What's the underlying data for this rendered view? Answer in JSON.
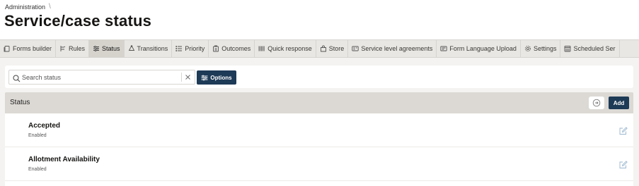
{
  "breadcrumb": {
    "items": [
      "Administration"
    ],
    "separator": "\\"
  },
  "page": {
    "title": "Service/case status"
  },
  "tabs": [
    {
      "label": "Forms builder",
      "icon": "forms-icon",
      "active": false
    },
    {
      "label": "Rules",
      "icon": "rules-icon",
      "active": false
    },
    {
      "label": "Status",
      "icon": "status-icon",
      "active": true
    },
    {
      "label": "Transitions",
      "icon": "transitions-icon",
      "active": false
    },
    {
      "label": "Priority",
      "icon": "priority-icon",
      "active": false
    },
    {
      "label": "Outcomes",
      "icon": "outcomes-icon",
      "active": false
    },
    {
      "label": "Quick response",
      "icon": "quick-response-icon",
      "active": false
    },
    {
      "label": "Store",
      "icon": "store-icon",
      "active": false
    },
    {
      "label": "Service level agreements",
      "icon": "sla-icon",
      "active": false
    },
    {
      "label": "Form Language Upload",
      "icon": "language-upload-icon",
      "active": false
    },
    {
      "label": "Settings",
      "icon": "settings-icon",
      "active": false
    },
    {
      "label": "Scheduled Ser",
      "icon": "scheduled-icon",
      "active": false
    }
  ],
  "search": {
    "placeholder": "Search status",
    "value": ""
  },
  "toolbar": {
    "options_label": "Options"
  },
  "list": {
    "title": "Status",
    "add_label": "Add",
    "rows": [
      {
        "name": "Accepted",
        "status": "Enabled"
      },
      {
        "name": "Allotment Availability",
        "status": "Enabled"
      }
    ]
  },
  "colors": {
    "primary": "#1d3a56",
    "active_tab": "#d6d3cd",
    "tabbar": "#e9e7e3",
    "list_header": "#dcd9d4"
  }
}
